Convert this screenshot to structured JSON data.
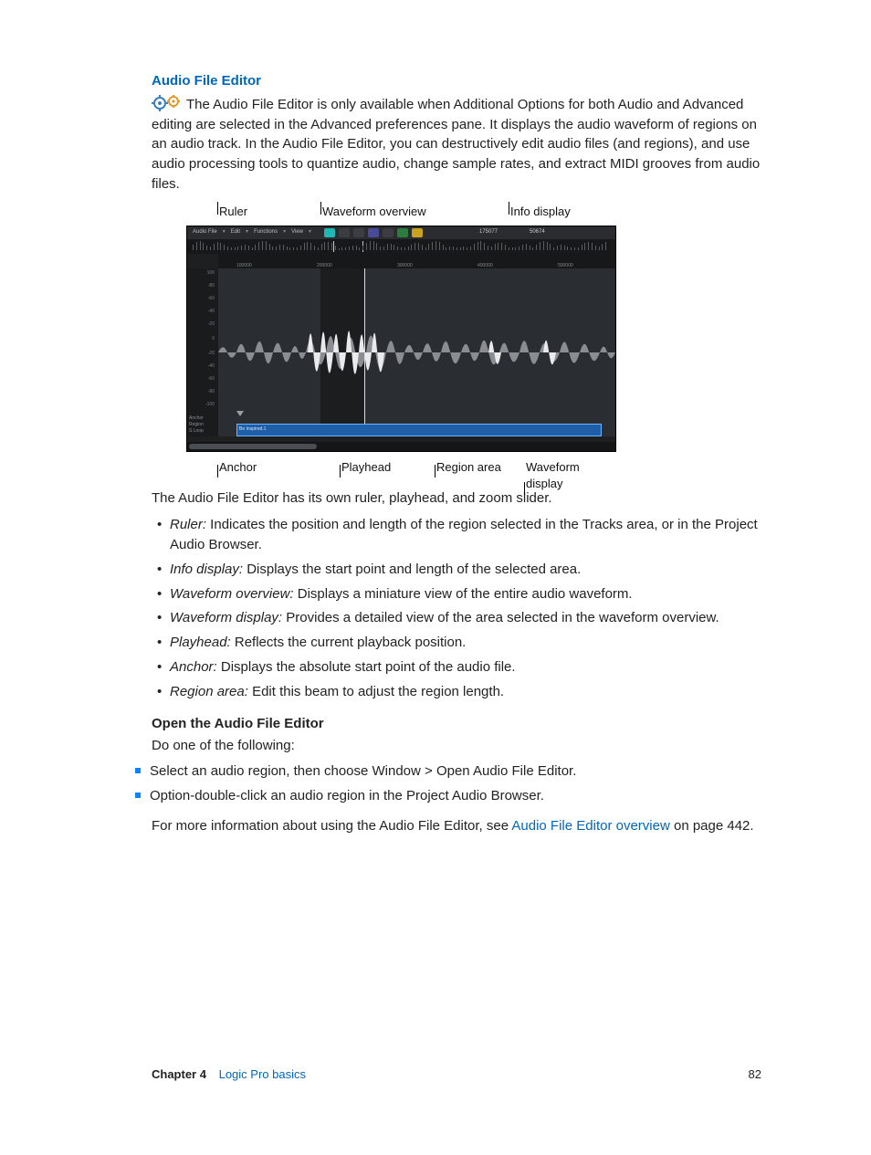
{
  "heading": "Audio File Editor",
  "intro": "The Audio File Editor is only available when Additional Options for both Audio and Advanced editing are selected in the Advanced preferences pane. It displays the audio waveform of regions on an audio track. In the Audio File Editor, you can destructively edit audio files (and regions), and use audio processing tools to quantize audio, change sample rates, and extract MIDI grooves from audio files.",
  "annotations_top": {
    "a": "Ruler",
    "b": "Waveform overview",
    "c": "Info display"
  },
  "annotations_bottom": {
    "a": "Anchor",
    "b": "Playhead",
    "c": "Region area",
    "d": "Waveform display"
  },
  "toolbar": {
    "menus": {
      "m1": "Audio File",
      "m2": "Edit",
      "m3": "Functions",
      "m4": "View"
    },
    "nums": {
      "n1": "175077",
      "n2": "50674"
    }
  },
  "ruler_ticks": {
    "t1": "100000",
    "t2": "200000",
    "t3": "300000",
    "t4": "400000",
    "t5": "500000"
  },
  "gutter": {
    "g1": "100",
    "g2": "-80",
    "g3": "-60",
    "g4": "-40",
    "g5": "-20",
    "g6": "0",
    "g7": "-20",
    "g8": "-40",
    "g9": "-60",
    "g10": "-80",
    "g11": "-100",
    "g12": "Anchor",
    "g13": "Region",
    "g14": "S Loop"
  },
  "region_label": "Be Inspired.1",
  "para_after_fig": "The Audio File Editor has its own ruler, playhead, and zoom slider.",
  "bullets": {
    "b1t": "Ruler:",
    "b1d": " Indicates the position and length of the region selected in the Tracks area, or in the Project Audio Browser.",
    "b2t": "Info display:",
    "b2d": " Displays the start point and length of the selected area.",
    "b3t": "Waveform overview:",
    "b3d": " Displays a miniature view of the entire audio waveform.",
    "b4t": "Waveform display:",
    "b4d": " Provides a detailed view of the area selected in the waveform overview.",
    "b5t": "Playhead:",
    "b5d": " Reflects the current playback position.",
    "b6t": "Anchor:",
    "b6d": " Displays the absolute start point of the audio file.",
    "b7t": "Region area:",
    "b7d": " Edit this beam to adjust the region length."
  },
  "subhead": "Open the Audio File Editor",
  "sub_intro": "Do one of the following:",
  "steps": {
    "s1": "Select an audio region, then choose Window > Open Audio File Editor.",
    "s2": "Option-double-click an audio region in the Project Audio Browser."
  },
  "closing_a": "For more information about using the Audio File Editor, see ",
  "closing_link": "Audio File Editor overview",
  "closing_b": " on page 442.",
  "footer": {
    "chapter": "Chapter  4",
    "title": "Logic Pro basics",
    "page": "82"
  }
}
